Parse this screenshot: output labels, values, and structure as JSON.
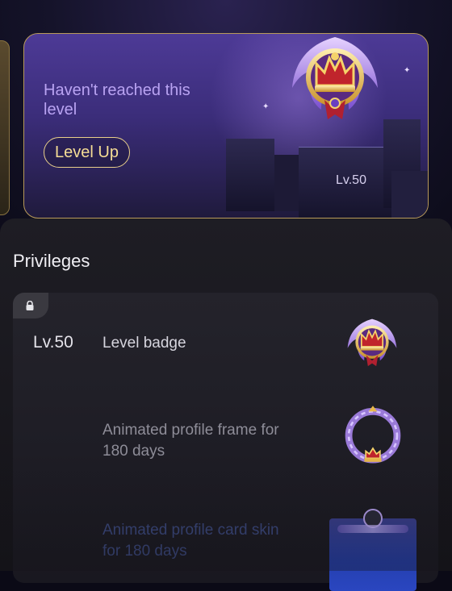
{
  "level_card": {
    "status": "Haven't reached this level",
    "button": "Level Up",
    "level": "Lv.50"
  },
  "privileges": {
    "title": "Privileges",
    "level": "Lv.50",
    "items": [
      {
        "label": "Level badge"
      },
      {
        "label": "Animated profile frame for 180 days"
      },
      {
        "label": "Animated profile card skin for 180 days"
      }
    ]
  },
  "colors": {
    "accent_gold": "#f5dd95",
    "card_purple": "#4d3a96",
    "muted_text": "#8e8d98"
  }
}
